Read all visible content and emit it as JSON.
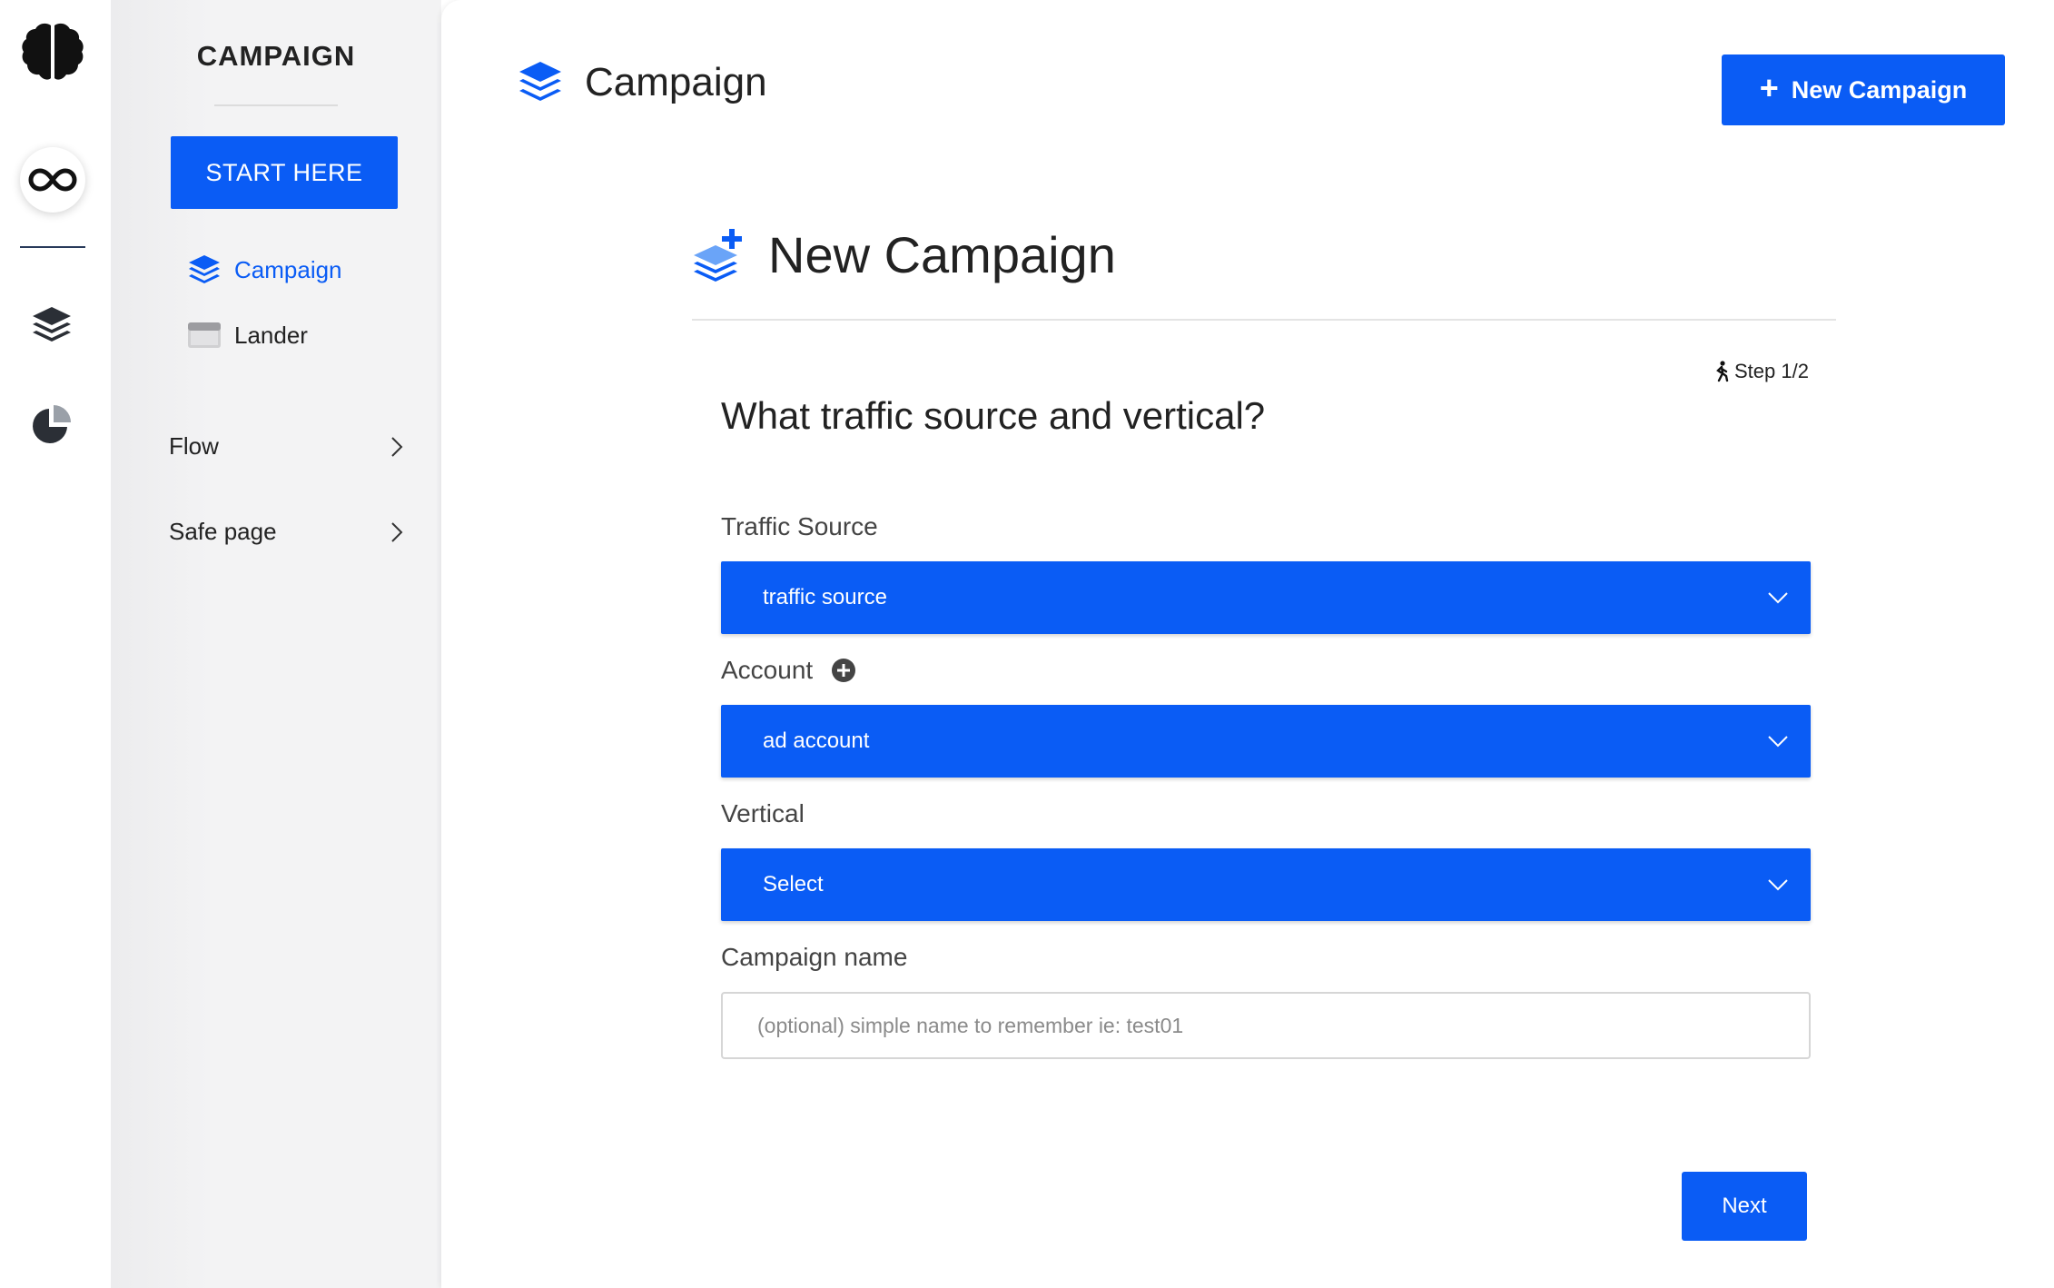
{
  "rail": {
    "icons": [
      "brain-icon",
      "infinity-icon",
      "layers-icon",
      "pie-chart-icon"
    ]
  },
  "sidebar": {
    "title": "CAMPAIGN",
    "start_button": "START HERE",
    "items": [
      {
        "label": "Campaign",
        "icon": "layers-icon",
        "active": true
      },
      {
        "label": "Lander",
        "icon": "browser-window-icon",
        "active": false
      }
    ],
    "groups": [
      {
        "label": "Flow"
      },
      {
        "label": "Safe page"
      }
    ]
  },
  "header": {
    "title": "Campaign",
    "new_campaign_button": "New Campaign"
  },
  "form": {
    "title": "New Campaign",
    "step": "Step 1/2",
    "question": "What traffic source and vertical?",
    "traffic_source": {
      "label": "Traffic Source",
      "value": "traffic source"
    },
    "account": {
      "label": "Account",
      "value": "ad account"
    },
    "vertical": {
      "label": "Vertical",
      "value": "Select"
    },
    "campaign_name": {
      "label": "Campaign name",
      "value": "",
      "placeholder": "(optional) simple name to remember ie: test01"
    },
    "next_button": "Next"
  },
  "colors": {
    "accent": "#0a5cf5",
    "sidebar_bg": "#f3f3f4",
    "text": "#222222"
  }
}
